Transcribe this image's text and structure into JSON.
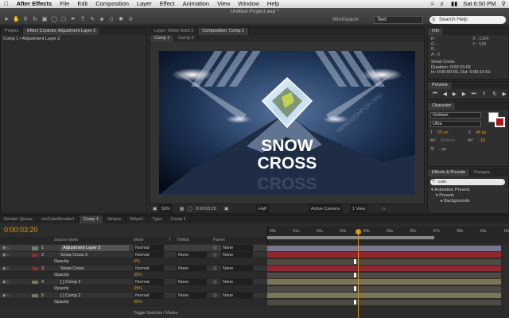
{
  "menubar": {
    "app": "After Effects",
    "items": [
      "File",
      "Edit",
      "Composition",
      "Layer",
      "Effect",
      "Animation",
      "View",
      "Window",
      "Help"
    ],
    "clock": "Sat 6:50 PM"
  },
  "toolbar": {
    "doc_title": "Untitled Project.aep *",
    "workspace_label": "Workspace:",
    "workspace_value": "Text",
    "search_placeholder": "Search Help"
  },
  "project": {
    "tab_project": "Project",
    "tab_effect_controls": "Effect Controls: Adjustment Layer 2",
    "breadcrumb": "Comp 1 • Adjustment Layer 2"
  },
  "comp": {
    "tab_layer": "Layer: White Solid 3",
    "tab_comp": "Composition: Comp 1",
    "subtab1": "Comp 1",
    "subtab2": "Comp 2",
    "title_line1": "SNOW",
    "title_line2": "CROSS",
    "watermark": "VANGOGHFOFORD",
    "zoom": "50%",
    "timecode": "0:00:03:20",
    "resolution": "Half",
    "camera": "Active Camera",
    "views": "1 View"
  },
  "info": {
    "title": "Info",
    "r": "R :",
    "g": "G :",
    "b": "B :",
    "a": "A : 0",
    "x": "X : 1324",
    "y": "Y : 530",
    "layer_name": "Snow Cross",
    "duration": "Duration: 0:00:10:02",
    "in_out": "In: 0:00:00:00, Out: 0:00:10:01"
  },
  "preview": {
    "title": "Preview"
  },
  "character": {
    "title": "Character",
    "font": "Gotham",
    "style": "Ultra",
    "size": "59 px",
    "leading": "48 px",
    "kerning": "Metrics",
    "tracking": "-18",
    "stroke": "- px"
  },
  "effects": {
    "title": "Effects & Presets",
    "tab2": "Paragra",
    "search": "curv",
    "tree": [
      "▾ Animation Presets",
      "▾ Presets",
      "▸ Backgrounds"
    ]
  },
  "timeline": {
    "tabs": [
      "Render Queue",
      "IceCubeRender1",
      "Comp 1",
      "Stripes",
      "Stripe1",
      "Type",
      "Comp 2"
    ],
    "timecode": "0:00:03:20",
    "headers": {
      "source": "Source Name",
      "mode": "Mode",
      "t": "T",
      "trkmat": "TrkMat",
      "parent": "Parent"
    },
    "ruler": [
      "00s",
      "01s",
      "02s",
      "03s",
      "04s",
      "05s",
      "06s",
      "07s",
      "08s",
      "09s",
      "10s"
    ],
    "layers": [
      {
        "num": "1",
        "name": "Adjustment Layer 2",
        "mode": "Normal",
        "trkmat": "",
        "parent": "None",
        "prop": false
      },
      {
        "num": "2",
        "name": "Snow Cross 2",
        "mode": "Normal",
        "trkmat": "None",
        "parent": "None",
        "prop": false
      },
      {
        "num": "",
        "name": "Opacity",
        "mode": "4%",
        "trkmat": "",
        "parent": "",
        "prop": true
      },
      {
        "num": "3",
        "name": "Snow Cross",
        "mode": "Normal",
        "trkmat": "None",
        "parent": "None",
        "prop": false
      },
      {
        "num": "",
        "name": "Opacity",
        "mode": "35%",
        "trkmat": "",
        "parent": "",
        "prop": true
      },
      {
        "num": "4",
        "name": "[ ] Comp 2",
        "mode": "Normal",
        "trkmat": "None",
        "parent": "None",
        "prop": false
      },
      {
        "num": "",
        "name": "Opacity",
        "mode": "35%",
        "trkmat": "",
        "parent": "",
        "prop": true
      },
      {
        "num": "5",
        "name": "[ ] Comp 2",
        "mode": "Normal",
        "trkmat": "None",
        "parent": "None",
        "prop": false
      },
      {
        "num": "",
        "name": "Opacity",
        "mode": "35%",
        "trkmat": "",
        "parent": "",
        "prop": true
      }
    ],
    "footer": "Toggle Switches / Modes"
  },
  "colors": {
    "accent": "#d9961c",
    "playhead": "#d9961c",
    "layer_red": "#8e2a2e",
    "layer_tan": "#7d7558",
    "layer_lav": "#7a7590"
  }
}
